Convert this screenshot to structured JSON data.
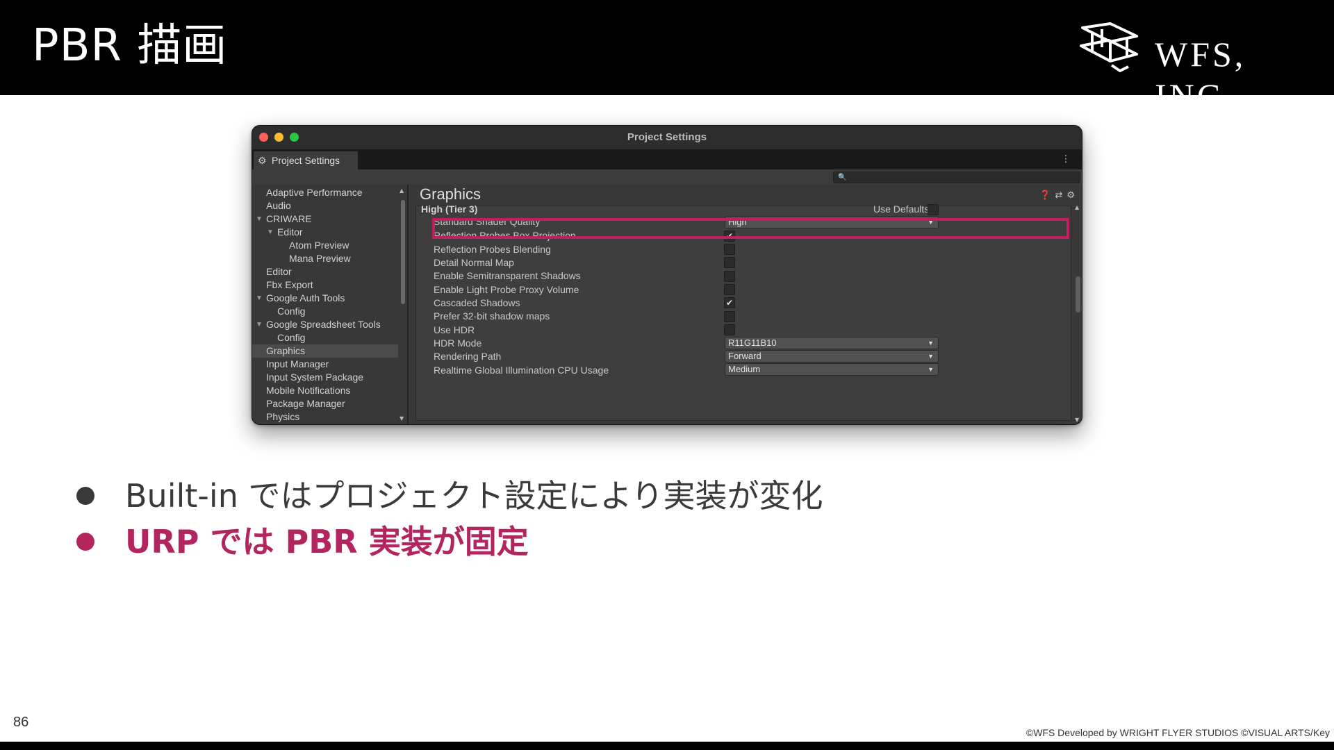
{
  "slide": {
    "title": "PBR 描画",
    "brand": "WFS, INC.",
    "page_number": "86",
    "copyright": "©WFS Developed by WRIGHT FLYER STUDIOS ©VISUAL ARTS/Key",
    "bullets": [
      "Built-in ではプロジェクト設定により実装が変化",
      "URP では PBR 実装が固定"
    ],
    "colors": {
      "accent": "#b2255e",
      "highlight_box": "#c01f61",
      "header_bg": "#000000"
    }
  },
  "window": {
    "title": "Project Settings",
    "tab_label": "Project Settings",
    "search_placeholder": "",
    "sidebar": [
      "Adaptive Performance",
      "Audio",
      "CRIWARE",
      "Editor",
      "Atom Preview",
      "Mana Preview",
      "Editor",
      "Fbx Export",
      "Google Auth Tools",
      "Config",
      "Google Spreadsheet Tools",
      "Config",
      "Graphics",
      "Input Manager",
      "Input System Package",
      "Mobile Notifications",
      "Package Manager",
      "Physics"
    ],
    "selected_sidebar_item": "Graphics",
    "graphics": {
      "title": "Graphics",
      "tier_label": "High (Tier 3)",
      "use_defaults_label": "Use Defaults",
      "settings": [
        {
          "label": "Standard Shader Quality",
          "type": "dropdown",
          "value": "High",
          "highlighted": true
        },
        {
          "label": "Reflection Probes Box Projection",
          "type": "checkbox",
          "checked": true
        },
        {
          "label": "Reflection Probes Blending",
          "type": "checkbox",
          "checked": false
        },
        {
          "label": "Detail Normal Map",
          "type": "checkbox",
          "checked": false
        },
        {
          "label": "Enable Semitransparent Shadows",
          "type": "checkbox",
          "checked": false
        },
        {
          "label": "Enable Light Probe Proxy Volume",
          "type": "checkbox",
          "checked": false
        },
        {
          "label": "Cascaded Shadows",
          "type": "checkbox",
          "checked": true
        },
        {
          "label": "Prefer 32-bit shadow maps",
          "type": "checkbox",
          "checked": false
        },
        {
          "label": "Use HDR",
          "type": "checkbox",
          "checked": false
        },
        {
          "label": "HDR Mode",
          "type": "dropdown",
          "value": "R11G11B10"
        },
        {
          "label": "Rendering Path",
          "type": "dropdown",
          "value": "Forward"
        },
        {
          "label": "Realtime Global Illumination CPU Usage",
          "type": "dropdown",
          "value": "Medium"
        }
      ]
    }
  }
}
